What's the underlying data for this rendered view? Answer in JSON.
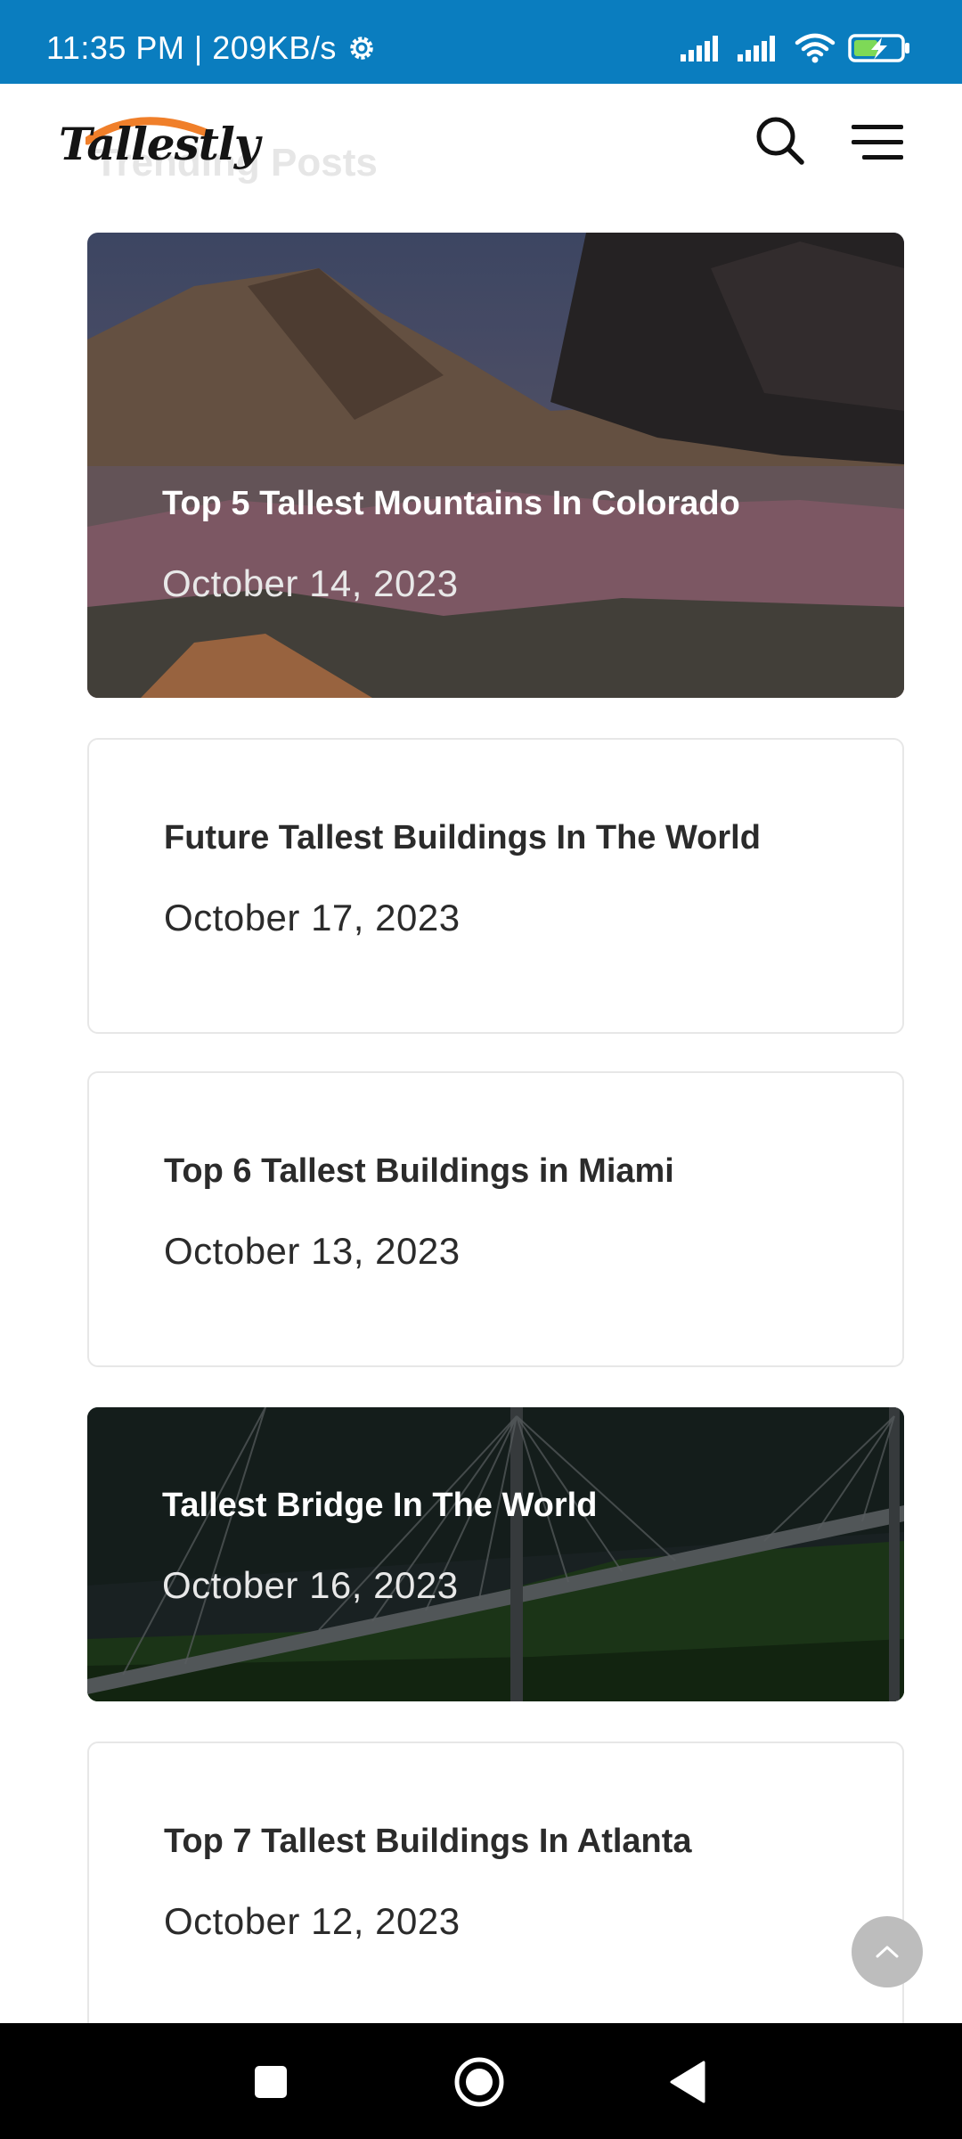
{
  "status_bar": {
    "time_speed": "11:35 PM | 209KB/s",
    "icons": [
      "settings-gear-icon",
      "signal-icon",
      "signal-icon",
      "wifi-icon",
      "battery-charging-icon"
    ]
  },
  "header": {
    "logo_text": "Tallestly",
    "ghost_heading": "Trending Posts",
    "icons": [
      "search-icon",
      "hamburger-menu-icon"
    ]
  },
  "posts": [
    {
      "title": "Top 5 Tallest Mountains In Colorado",
      "date": "October 14, 2023",
      "style": "image"
    },
    {
      "title": "Future Tallest Buildings In The World",
      "date": "October 17, 2023",
      "style": "plain"
    },
    {
      "title": "Top 6 Tallest Buildings in Miami",
      "date": "October 13, 2023",
      "style": "plain"
    },
    {
      "title": "Tallest Bridge In The World",
      "date": "October 16, 2023",
      "style": "image"
    },
    {
      "title": "Top 7 Tallest Buildings In Atlanta",
      "date": "October 12, 2023",
      "style": "plain"
    }
  ],
  "scroll_top": {
    "icon": "chevron-up-icon"
  },
  "nav_bar": {
    "icons": [
      "recents-square-icon",
      "home-circle-icon",
      "back-triangle-icon"
    ]
  },
  "colors": {
    "status_bar": "#0a7dbf",
    "logo_swoosh": "#f07f2a",
    "card_border": "#e7e7e7",
    "text_dark": "#2b2b2b"
  }
}
